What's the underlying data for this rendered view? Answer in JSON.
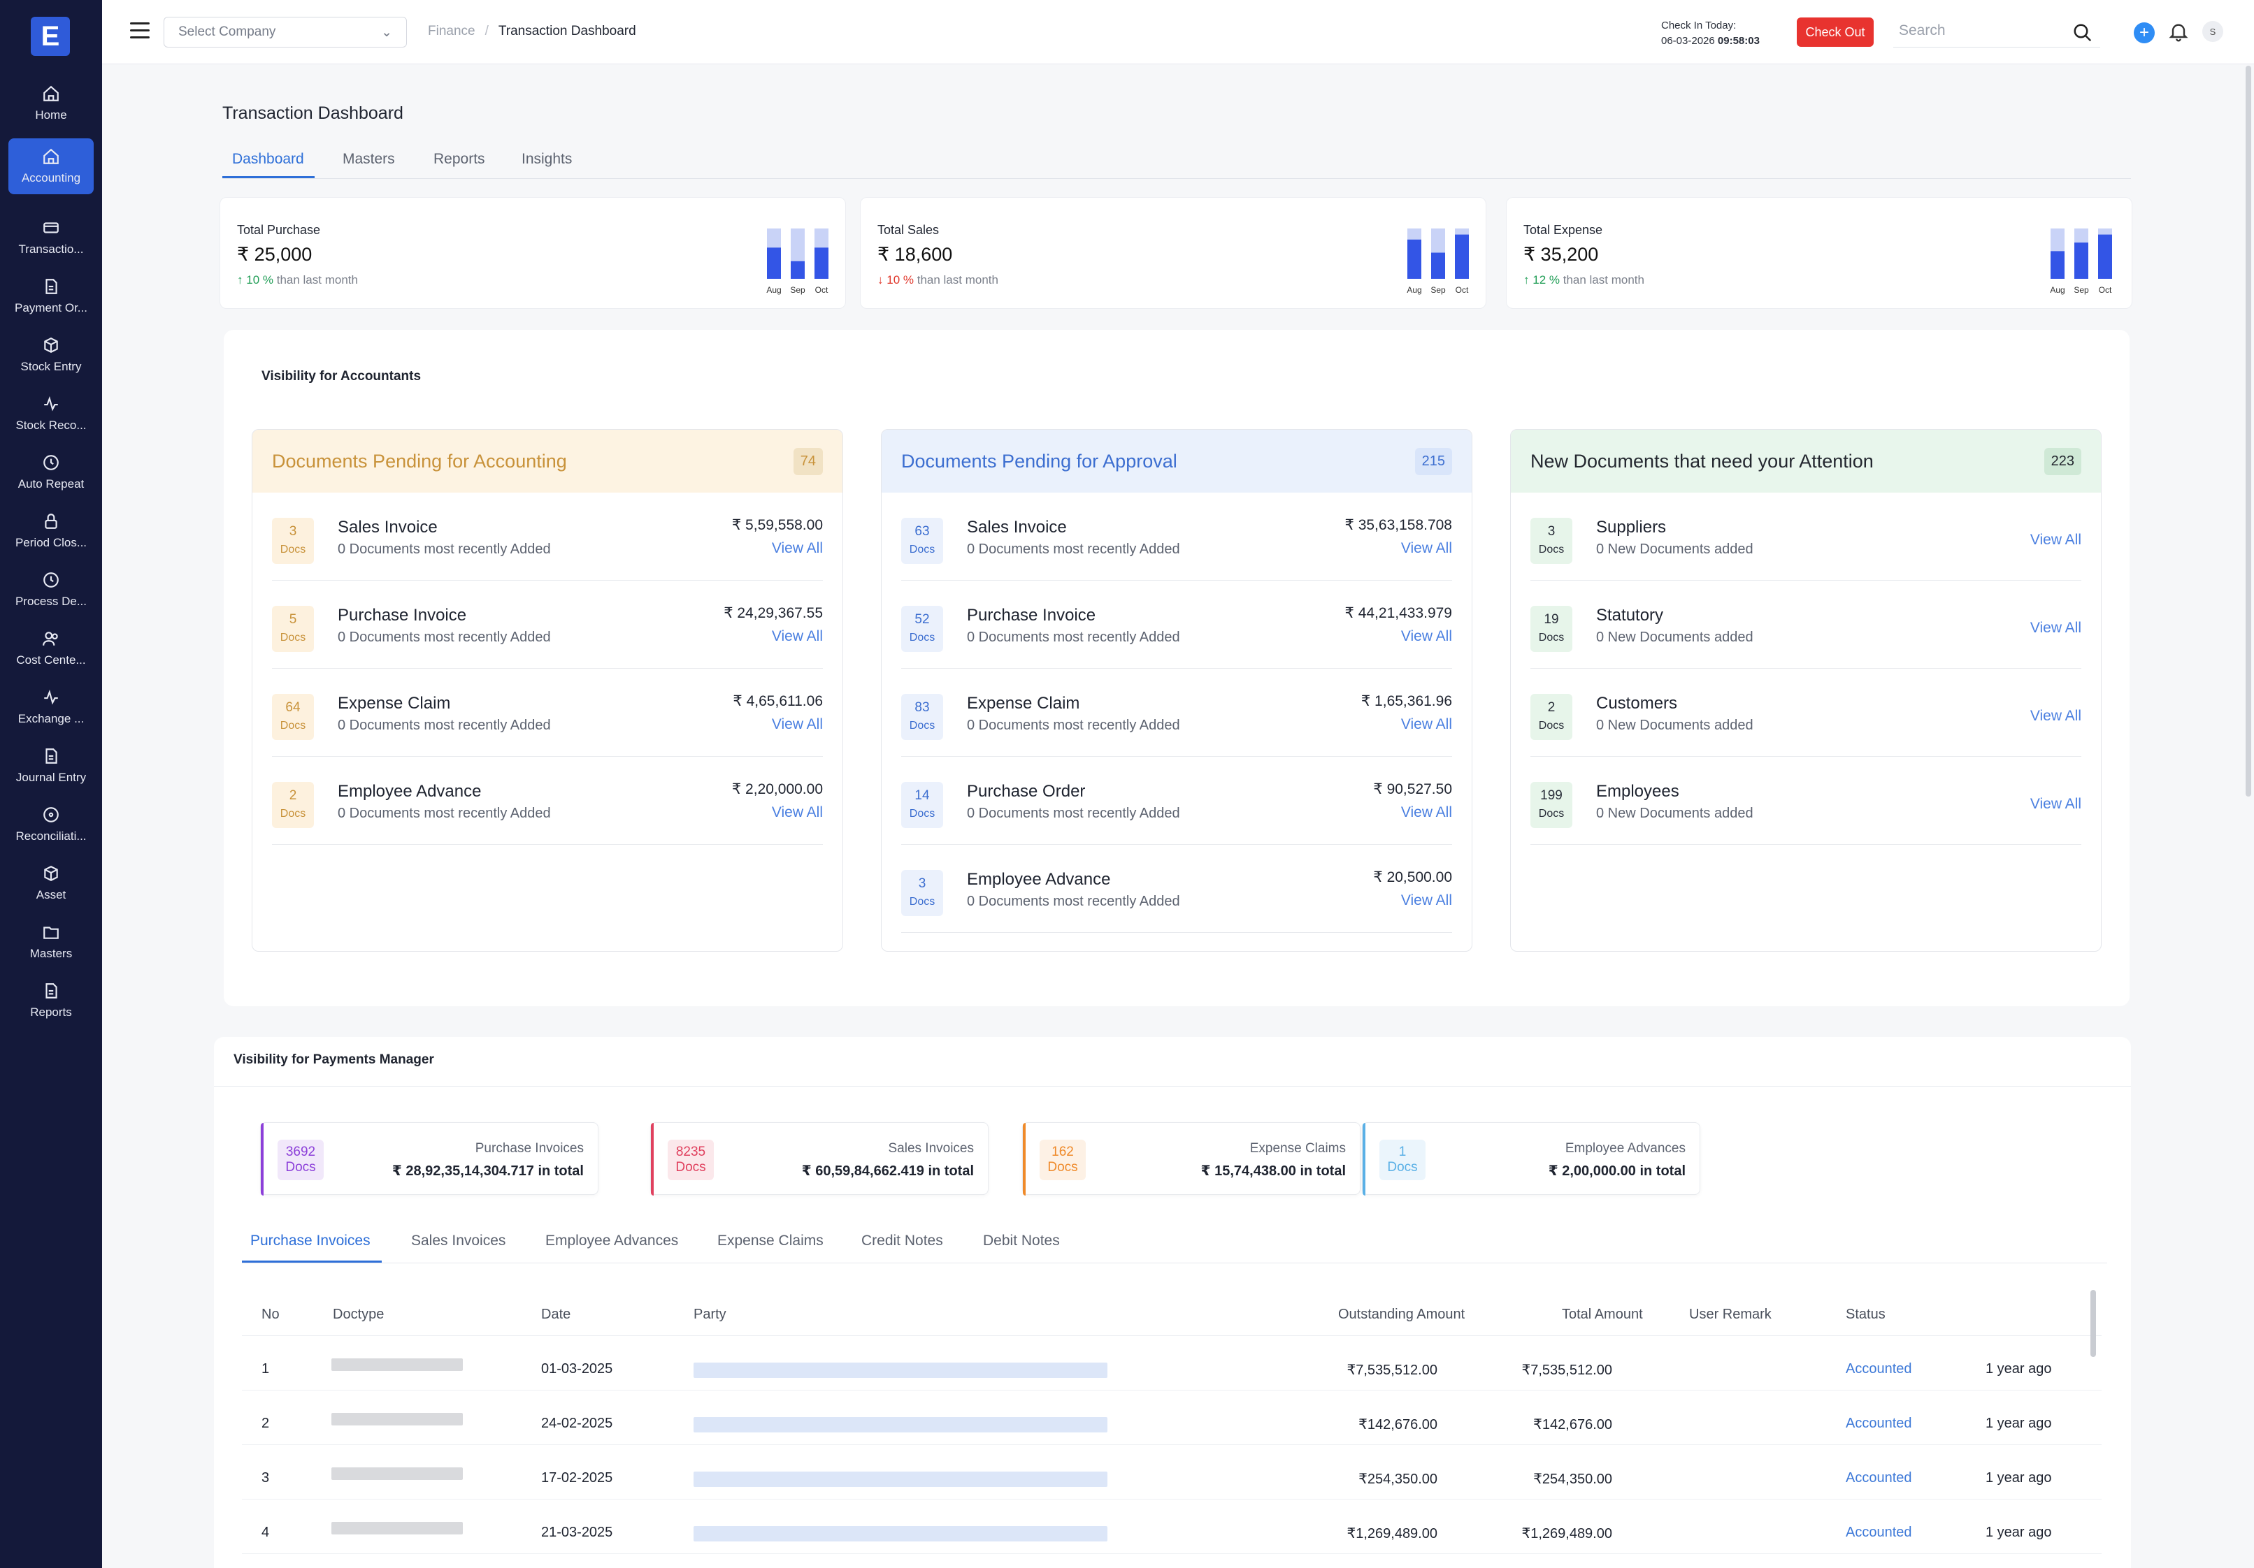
{
  "sidebar": {
    "logo": "E",
    "items": [
      {
        "label": "Home",
        "icon": "home-icon"
      },
      {
        "label": "Accounting",
        "icon": "home-icon"
      },
      {
        "label": "Transactio...",
        "icon": "card-icon"
      },
      {
        "label": "Payment Or...",
        "icon": "document-icon"
      },
      {
        "label": "Stock Entry",
        "icon": "box-icon"
      },
      {
        "label": "Stock Reco...",
        "icon": "activity-icon"
      },
      {
        "label": "Auto Repeat",
        "icon": "clock-icon"
      },
      {
        "label": "Period Clos...",
        "icon": "lock-icon"
      },
      {
        "label": "Process De...",
        "icon": "clock-icon"
      },
      {
        "label": "Cost Cente...",
        "icon": "users-icon"
      },
      {
        "label": "Exchange ...",
        "icon": "activity-icon"
      },
      {
        "label": "Journal Entry",
        "icon": "document-icon"
      },
      {
        "label": "Reconciliati...",
        "icon": "circle-icon"
      },
      {
        "label": "Asset",
        "icon": "box-icon"
      },
      {
        "label": "Masters",
        "icon": "folder-icon"
      },
      {
        "label": "Reports",
        "icon": "document-icon"
      }
    ]
  },
  "topbar": {
    "company_placeholder": "Select Company",
    "breadcrumb_root": "Finance",
    "breadcrumb_sep": "/",
    "breadcrumb_current": "Transaction Dashboard",
    "checkin_label": "Check In Today:",
    "checkin_date": "06-03-2026",
    "checkin_time": "09:58:03",
    "checkout_label": "Check Out",
    "search_placeholder": "Search",
    "avatar_initial": "S"
  },
  "page": {
    "title": "Transaction Dashboard",
    "tabs": [
      "Dashboard",
      "Masters",
      "Reports",
      "Insights"
    ]
  },
  "stats": [
    {
      "label": "Total Purchase",
      "value": "₹ 25,000",
      "arrow": "↑",
      "pct": "10 %",
      "note": "than last month",
      "bars": [
        0.62,
        0.35,
        0.62
      ],
      "months": [
        "Aug",
        "Sep",
        "Oct"
      ]
    },
    {
      "label": "Total Sales",
      "value": "₹ 18,600",
      "arrow": "↓",
      "pct": "10 %",
      "note": "than last month",
      "bars": [
        0.78,
        0.52,
        0.88
      ],
      "months": [
        "Aug",
        "Sep",
        "Oct"
      ]
    },
    {
      "label": "Total Expense",
      "value": "₹ 35,200",
      "arrow": "↑",
      "pct": "12 %",
      "note": "than last month",
      "bars": [
        0.55,
        0.72,
        0.88
      ],
      "months": [
        "Aug",
        "Sep",
        "Oct"
      ]
    }
  ],
  "accountants": {
    "title": "Visibility for Accountants",
    "docs_label": "Docs",
    "view_all": "View All",
    "pending_accounting": {
      "title": "Documents Pending for Accounting",
      "count": "74",
      "rows": [
        {
          "count": "3",
          "name": "Sales Invoice",
          "sub": "0 Documents most recently Added",
          "amount": "₹ 5,59,558.00"
        },
        {
          "count": "5",
          "name": "Purchase Invoice",
          "sub": "0 Documents most recently Added",
          "amount": "₹ 24,29,367.55"
        },
        {
          "count": "64",
          "name": "Expense Claim",
          "sub": "0 Documents most recently Added",
          "amount": "₹ 4,65,611.06"
        },
        {
          "count": "2",
          "name": "Employee Advance",
          "sub": "0 Documents most recently Added",
          "amount": "₹ 2,20,000.00"
        }
      ]
    },
    "pending_approval": {
      "title": "Documents Pending for Approval",
      "count": "215",
      "rows": [
        {
          "count": "63",
          "name": "Sales Invoice",
          "sub": "0 Documents most recently Added",
          "amount": "₹ 35,63,158.708"
        },
        {
          "count": "52",
          "name": "Purchase Invoice",
          "sub": "0 Documents most recently Added",
          "amount": "₹ 44,21,433.979"
        },
        {
          "count": "83",
          "name": "Expense Claim",
          "sub": "0 Documents most recently Added",
          "amount": "₹ 1,65,361.96"
        },
        {
          "count": "14",
          "name": "Purchase Order",
          "sub": "0 Documents most recently Added",
          "amount": "₹ 90,527.50"
        },
        {
          "count": "3",
          "name": "Employee Advance",
          "sub": "0 Documents most recently Added",
          "amount": "₹ 20,500.00"
        }
      ]
    },
    "new_docs": {
      "title": "New Documents that need your Attention",
      "count": "223",
      "rows": [
        {
          "count": "3",
          "name": "Suppliers",
          "sub": "0 New Documents added"
        },
        {
          "count": "19",
          "name": "Statutory",
          "sub": "0 New Documents added"
        },
        {
          "count": "2",
          "name": "Customers",
          "sub": "0 New Documents added"
        },
        {
          "count": "199",
          "name": "Employees",
          "sub": "0 New Documents added"
        }
      ]
    }
  },
  "payments": {
    "title": "Visibility for Payments Manager",
    "docs_label": "Docs",
    "summary": [
      {
        "count": "3692",
        "label": "Purchase Invoices",
        "total": "₹ 28,92,35,14,304.717 in total",
        "color": "#8c3fd9"
      },
      {
        "count": "8235",
        "label": "Sales Invoices",
        "total": "₹ 60,59,84,662.419 in total",
        "color": "#e0405e"
      },
      {
        "count": "162",
        "label": "Expense Claims",
        "total": "₹ 15,74,438.00 in total",
        "color": "#ef8a2a"
      },
      {
        "count": "1",
        "label": "Employee Advances",
        "total": "₹ 2,00,000.00 in total",
        "color": "#5ab0e6"
      }
    ],
    "tabs": [
      "Purchase Invoices",
      "Sales Invoices",
      "Employee Advances",
      "Expense Claims",
      "Credit Notes",
      "Debit Notes"
    ],
    "columns": [
      "No",
      "Doctype",
      "Date",
      "Party",
      "Outstanding Amount",
      "Total Amount",
      "User Remark",
      "Status"
    ],
    "rows": [
      {
        "no": "1",
        "date": "01-03-2025",
        "outstanding": "₹7,535,512.00",
        "total": "₹7,535,512.00",
        "status": "Accounted",
        "ago": "1 year ago"
      },
      {
        "no": "2",
        "date": "24-02-2025",
        "outstanding": "₹142,676.00",
        "total": "₹142,676.00",
        "status": "Accounted",
        "ago": "1 year ago"
      },
      {
        "no": "3",
        "date": "17-02-2025",
        "outstanding": "₹254,350.00",
        "total": "₹254,350.00",
        "status": "Accounted",
        "ago": "1 year ago"
      },
      {
        "no": "4",
        "date": "21-03-2025",
        "outstanding": "₹1,269,489.00",
        "total": "₹1,269,489.00",
        "status": "Accounted",
        "ago": "1 year ago"
      }
    ]
  },
  "colors": {
    "sidebar_bg": "#14193a",
    "accent": "#2e6fd8",
    "checkout": "#e8332f",
    "accounting_head": "#fdf3e2",
    "approval_head": "#eaf1fc",
    "attention_head": "#e8f6ec"
  }
}
